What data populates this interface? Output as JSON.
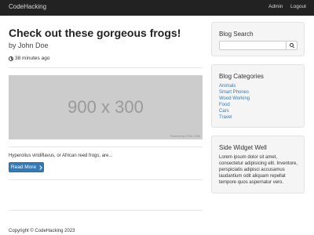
{
  "navbar": {
    "brand": "CodeHacking",
    "links": [
      "Admin",
      "Logout"
    ]
  },
  "post": {
    "title": "Check out these gorgeous frogs!",
    "byline_prefix": "by ",
    "author": "John Doe",
    "posted": "38 minutes ago",
    "image_placeholder": "900 x 300",
    "image_credit": "Powered by HTML.COM",
    "excerpt": "Hyperolius viridiflavus, or African reed frogs, are...",
    "read_more": "Read More"
  },
  "sidebar": {
    "search": {
      "title": "Blog Search",
      "placeholder": ""
    },
    "categories": {
      "title": "Blog Categories",
      "items": [
        "Animals",
        "Smart Phones",
        "Wood Working",
        "Food",
        "Cars",
        "Travel"
      ]
    },
    "side_widget": {
      "title": "Side Widget Well",
      "text": "Lorem ipsum dolor sit amet, consectetur adipisicing elit. Inventore, perspiciatis adipisci accusamus laudantium odit aliquam repellat tempore quos aspernatur vero."
    }
  },
  "footer": {
    "copyright": "Copyright © CodeHacking 2023"
  },
  "colors": {
    "navbar": "#222222",
    "link": "#337ab7",
    "button": "#337ab7",
    "well": "#f5f5f5"
  },
  "icons": {
    "posted": "clock-icon",
    "read_more": "chevron-right-icon",
    "search": "search-icon"
  }
}
